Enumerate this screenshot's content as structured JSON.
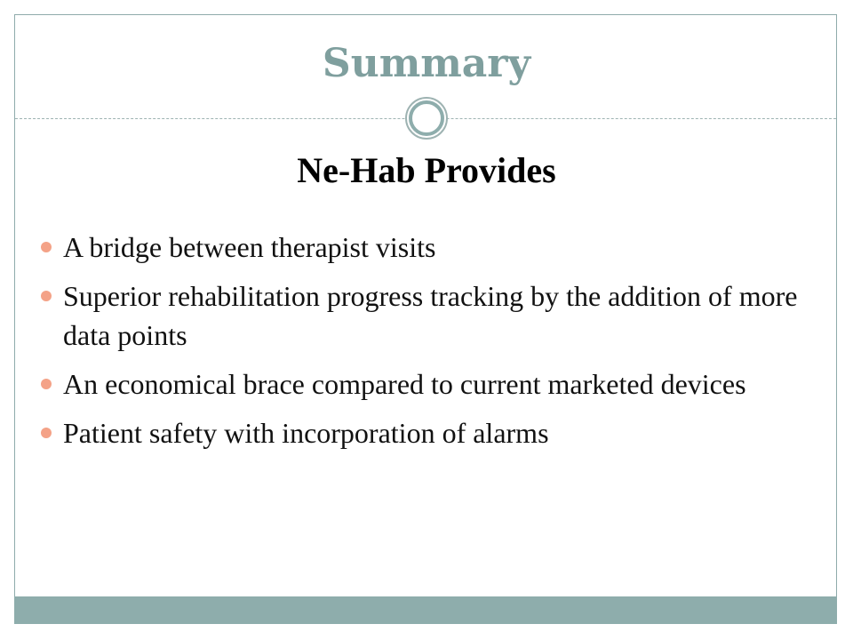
{
  "slide": {
    "title": "Summary",
    "subtitle": "Ne-Hab Provides",
    "bullets": [
      "A bridge between therapist visits",
      "Superior rehabilitation progress tracking by the addition of more data points",
      "An economical brace compared to current marketed devices",
      "Patient safety with incorporation of alarms"
    ]
  },
  "colors": {
    "title": "#7f9f9e",
    "accent_bar": "#8eadac",
    "bullet": "#f4a287",
    "frame": "#8fabab"
  },
  "icons": {
    "divider_ornament": "ring-ornament-icon",
    "bullet_marker": "bullet-dot-icon"
  }
}
